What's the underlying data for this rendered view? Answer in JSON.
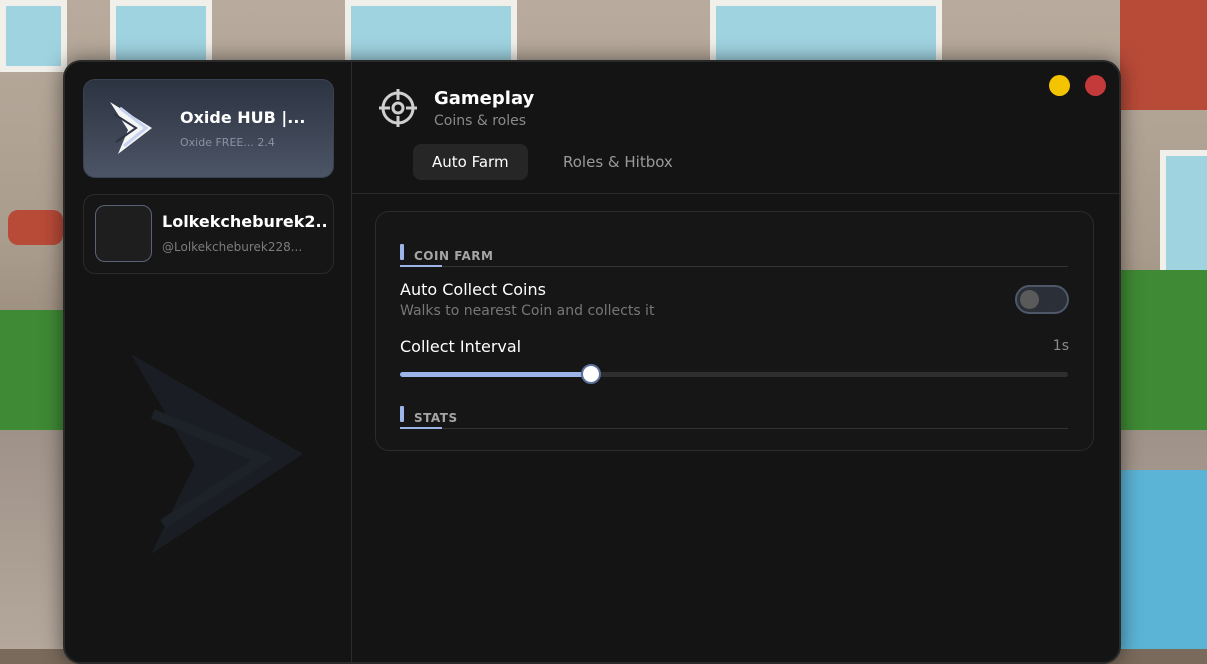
{
  "sidebar": {
    "hub": {
      "title": "Oxide HUB |...",
      "subtitle": "Oxide FREE... 2.4"
    },
    "user": {
      "name": "Lolkekcheburek2...",
      "handle": "@Lolkekcheburek228..."
    }
  },
  "header": {
    "title": "Gameplay",
    "subtitle": "Coins & roles"
  },
  "tabs": [
    {
      "label": "Auto Farm",
      "active": true
    },
    {
      "label": "Roles & Hitbox",
      "active": false
    }
  ],
  "panel": {
    "sections": [
      {
        "label": "COIN FARM"
      },
      {
        "label": "STATS"
      }
    ],
    "auto_collect": {
      "label": "Auto Collect Coins",
      "description": "Walks to nearest Coin and collects it",
      "enabled": false
    },
    "collect_interval": {
      "label": "Collect Interval",
      "value_text": "1s",
      "fraction": 0.286
    }
  },
  "colors": {
    "accent": "#9cb4e8",
    "minimize": "#f5c400",
    "close": "#c43a3a",
    "window_bg": "#141414"
  },
  "icons": {
    "header": "crosshair-icon",
    "logo": "oxide-logo-icon"
  }
}
